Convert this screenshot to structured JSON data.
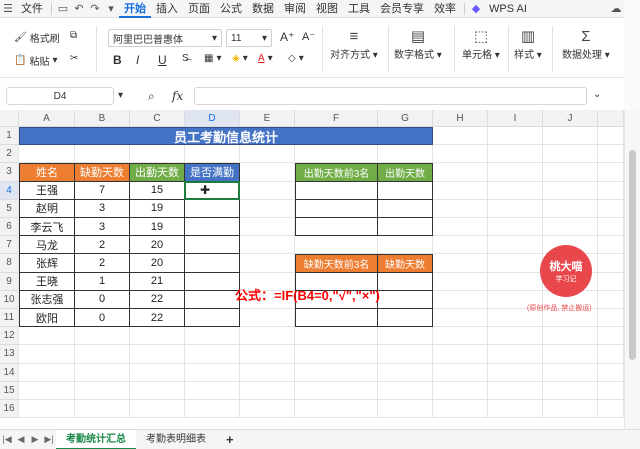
{
  "menubar": {
    "items": [
      "文件",
      "开始",
      "插入",
      "页面",
      "公式",
      "数据",
      "审阅",
      "视图",
      "工具",
      "会员专享",
      "效率"
    ],
    "active": "开始",
    "wps_ai": "WPS AI"
  },
  "ribbon": {
    "format_painter": "格式刷",
    "paste": "粘贴",
    "font_name": "阿里巴巴普惠体",
    "font_size": "11",
    "bold": "B",
    "italic": "I",
    "underline": "U",
    "align": "对齐方式",
    "number_format": "数字格式",
    "cells": "单元格",
    "styles": "样式",
    "data_processing": "数据处理"
  },
  "formula_bar": {
    "name_box": "D4",
    "fx": "fx",
    "value": ""
  },
  "grid": {
    "columns": [
      "A",
      "B",
      "C",
      "D",
      "E",
      "F",
      "G",
      "H",
      "I",
      "J"
    ],
    "rows": [
      "1",
      "2",
      "3",
      "4",
      "5",
      "6",
      "7",
      "8",
      "9",
      "10",
      "11",
      "12",
      "13",
      "14",
      "15",
      "16"
    ],
    "selected_col": "D",
    "selected_row": "4"
  },
  "table": {
    "title": "员工考勤信息统计",
    "headers": [
      "姓名",
      "缺勤天数",
      "出勤天数",
      "是否满勤"
    ],
    "rows": [
      [
        "王强",
        "7",
        "15",
        ""
      ],
      [
        "赵明",
        "3",
        "19",
        ""
      ],
      [
        "李云飞",
        "3",
        "19",
        ""
      ],
      [
        "马龙",
        "2",
        "20",
        ""
      ],
      [
        "张辉",
        "2",
        "20",
        ""
      ],
      [
        "王晓",
        "1",
        "21",
        ""
      ],
      [
        "张志强",
        "0",
        "22",
        ""
      ],
      [
        "欧阳",
        "0",
        "22",
        ""
      ]
    ]
  },
  "top3_attendance": {
    "headers": [
      "出勤天数前3名",
      "出勤天数"
    ]
  },
  "top3_absence": {
    "headers": [
      "缺勤天数前3名",
      "缺勤天数"
    ]
  },
  "formula_note": "公式：=IF(B4=0,\"√\",\"×\")",
  "stamp": {
    "line1": "桃大喵",
    "line2": "学习记",
    "note": "(原创作品, 禁止搬运)"
  },
  "sheet_tabs": [
    "考勤统计汇总",
    "考勤表明细表"
  ],
  "active_sheet": "考勤统计汇总",
  "add_sheet": "+",
  "colors": {
    "blue_header": "#4472c4",
    "orange_header": "#ed7d31",
    "green_header": "#70ad47",
    "formula_red": "#ff0000",
    "accent": "#1a6fe0"
  }
}
